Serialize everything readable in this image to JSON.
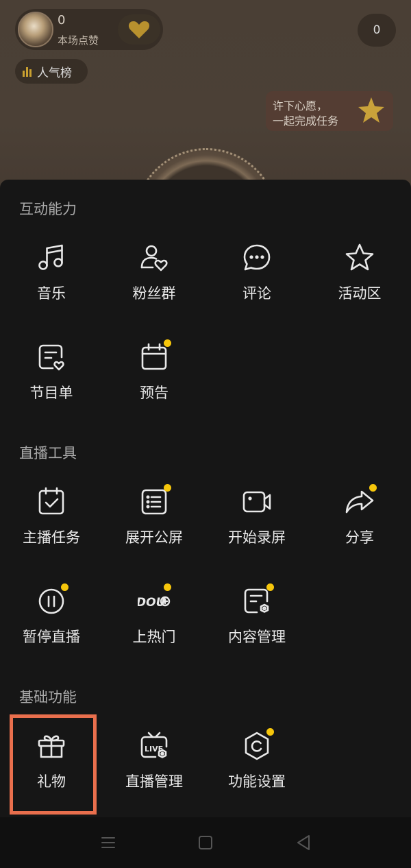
{
  "background": {
    "like_count": "0",
    "like_label": "本场点赞",
    "viewer_count": "0",
    "rank_label": "人气榜",
    "wish_line1": "许下心愿，",
    "wish_line2": "一起完成任务"
  },
  "sections": [
    {
      "title": "互动能力",
      "items": [
        {
          "label": "音乐",
          "icon": "music-icon",
          "dot": false
        },
        {
          "label": "粉丝群",
          "icon": "fan-group-icon",
          "dot": false
        },
        {
          "label": "评论",
          "icon": "comment-icon",
          "dot": false
        },
        {
          "label": "活动区",
          "icon": "star-icon",
          "dot": false
        },
        {
          "label": "节目单",
          "icon": "program-list-icon",
          "dot": false
        },
        {
          "label": "预告",
          "icon": "calendar-icon",
          "dot": true
        }
      ]
    },
    {
      "title": "直播工具",
      "items": [
        {
          "label": "主播任务",
          "icon": "task-icon",
          "dot": false
        },
        {
          "label": "展开公屏",
          "icon": "public-screen-icon",
          "dot": true
        },
        {
          "label": "开始录屏",
          "icon": "record-icon",
          "dot": false
        },
        {
          "label": "分享",
          "icon": "share-icon",
          "dot": true
        },
        {
          "label": "暂停直播",
          "icon": "pause-icon",
          "dot": true
        },
        {
          "label": "上热门",
          "icon": "dou-plus-icon",
          "dot": true
        },
        {
          "label": "内容管理",
          "icon": "content-manage-icon",
          "dot": true
        }
      ]
    },
    {
      "title": "基础功能",
      "items": [
        {
          "label": "礼物",
          "icon": "gift-icon",
          "dot": false
        },
        {
          "label": "直播管理",
          "icon": "live-manage-icon",
          "dot": false
        },
        {
          "label": "功能设置",
          "icon": "settings-icon",
          "dot": true
        }
      ]
    }
  ],
  "accent_colors": {
    "dot": "#f6c60b",
    "highlight": "#e96f4d"
  }
}
